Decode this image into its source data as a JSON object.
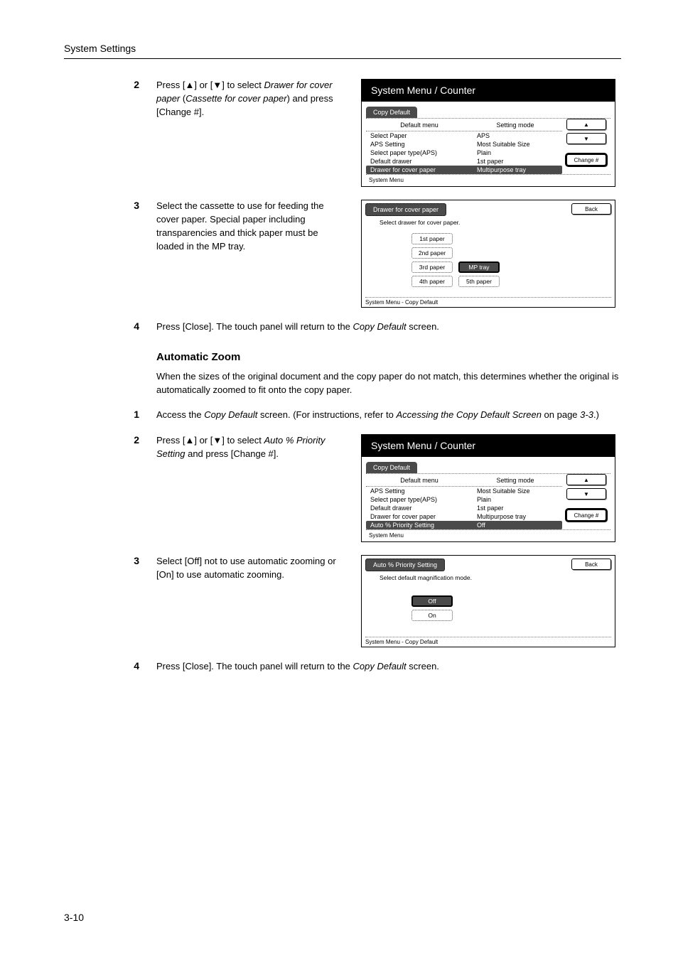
{
  "header": {
    "title": "System Settings"
  },
  "panelTitle": "System Menu / Counter",
  "copyDefaultTab": "Copy Default",
  "menuHead": {
    "left": "Default menu",
    "right": "Setting mode"
  },
  "footer1": "System Menu",
  "footer2": "System Menu         -    Copy Default",
  "btns": {
    "change": "Change #",
    "back": "Back"
  },
  "step2a": {
    "num": "2",
    "t1": "Press [",
    "t2": "] or [",
    "t3": "] to select ",
    "i1": "Drawer for cover paper",
    "t4": " (",
    "i2": "Cassette for cover paper",
    "t5": ") and press [Change #].",
    "rows": [
      {
        "a": "Select Paper",
        "b": "APS"
      },
      {
        "a": "APS Setting",
        "b": "Most Suitable Size"
      },
      {
        "a": "Select paper type(APS)",
        "b": "Plain"
      },
      {
        "a": "Default drawer",
        "b": "1st paper"
      },
      {
        "a": "Drawer for cover paper",
        "b": "Multipurpose tray",
        "sel": true
      }
    ]
  },
  "step3a": {
    "num": "3",
    "text": "Select the cassette to use for feeding the cover paper. Special paper including transparencies and thick paper must be loaded in the MP tray.",
    "tab": "Drawer for cover paper",
    "hint": "Select drawer for cover paper.",
    "opts": [
      [
        "1st paper",
        ""
      ],
      [
        "2nd paper",
        ""
      ],
      [
        "3rd paper",
        "MP tray"
      ],
      [
        "4th paper",
        "5th paper"
      ]
    ]
  },
  "step4": {
    "num": "4",
    "t1": "Press [Close]. The touch panel will return to the ",
    "i1": "Copy Default",
    "t2": " screen."
  },
  "zoom": {
    "heading": "Automatic Zoom",
    "intro": "When the sizes of the original document and the copy paper do not match, this determines whether the original is automatically zoomed to fit onto the copy paper."
  },
  "step1b": {
    "num": "1",
    "t1": "Access the ",
    "i1": "Copy Default",
    "t2": " screen. (For instructions, refer to ",
    "i2": "Accessing the Copy Default Screen",
    "t3": " on page ",
    "i3": "3-3",
    "t4": ".)"
  },
  "step2b": {
    "num": "2",
    "t1": "Press [",
    "t2": "] or [",
    "t3": "] to select ",
    "i1": "Auto % Priority Setting",
    "t4": " and press [Change #].",
    "rows": [
      {
        "a": "APS Setting",
        "b": "Most Suitable Size"
      },
      {
        "a": "Select paper type(APS)",
        "b": "Plain"
      },
      {
        "a": "Default drawer",
        "b": "1st paper"
      },
      {
        "a": "Drawer for cover paper",
        "b": "Multipurpose tray"
      },
      {
        "a": "Auto % Priority Setting",
        "b": "Off",
        "sel": true
      }
    ]
  },
  "step3b": {
    "num": "3",
    "text": "Select [Off] not to use automatic zooming or [On] to use automatic zooming.",
    "tab": "Auto % Priority Setting",
    "hint": "Select default magnification mode.",
    "opts": [
      "Off",
      "On"
    ]
  },
  "pageNum": "3-10"
}
